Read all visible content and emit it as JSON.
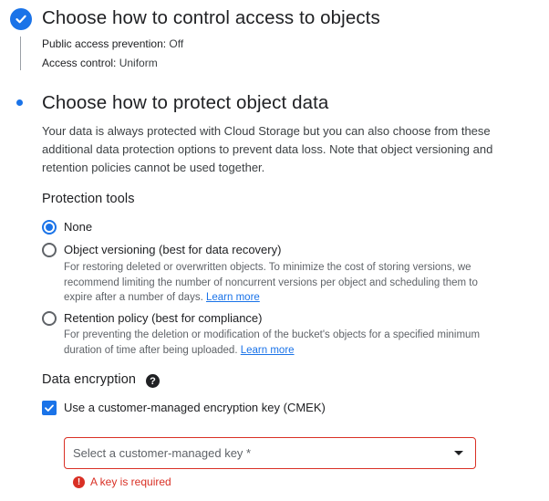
{
  "colors": {
    "accent": "#1a73e8",
    "error": "#d93025",
    "text": "#202124",
    "secondary": "#5f6368"
  },
  "step_access": {
    "icon": "check-circle-icon",
    "title": "Choose how to control access to objects",
    "public_access_label": "Public access prevention:",
    "public_access_value": "Off",
    "access_control_label": "Access control:",
    "access_control_value": "Uniform"
  },
  "step_protect": {
    "title": "Choose how to protect object data",
    "description": "Your data is always protected with Cloud Storage but you can also choose from these additional data protection options to prevent data loss. Note that object versioning and retention policies cannot be used together."
  },
  "protection_tools": {
    "heading": "Protection tools",
    "selected": "none",
    "options": [
      {
        "label": "None"
      },
      {
        "label": "Object versioning (best for data recovery)",
        "help": "For restoring deleted or overwritten objects. To minimize the cost of storing versions, we recommend limiting the number of noncurrent versions per object and scheduling them to expire after a number of days.",
        "link": "Learn more"
      },
      {
        "label": "Retention policy (best for compliance)",
        "help": "For preventing the deletion or modification of the bucket's objects for a specified minimum duration of time after being uploaded.",
        "link": "Learn more"
      }
    ]
  },
  "data_encryption": {
    "heading": "Data encryption",
    "help_icon": "help-circle-icon",
    "cmek_label": "Use a customer-managed encryption key (CMEK)",
    "cmek_checked": true,
    "key_select_placeholder": "Select a customer-managed key *",
    "error_icon": "error-icon",
    "error_text": "A key is required"
  }
}
